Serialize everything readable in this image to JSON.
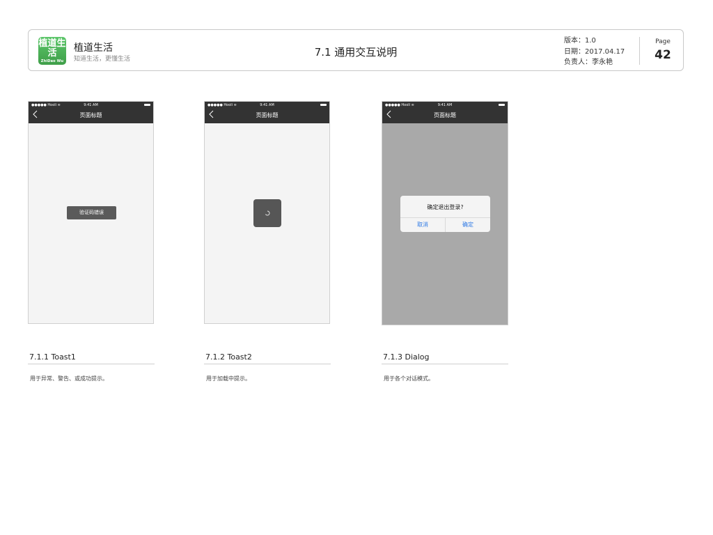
{
  "header": {
    "logo": {
      "main": "植道生活",
      "sub": "ZhiDao Wu",
      "color": "#4caf50"
    },
    "app_name": "植道生活",
    "slogan": "知道生活，更懂生活",
    "page_title": "7.1 通用交互说明",
    "version": "版本：1.0",
    "date": "日期：2017.04.17",
    "owner": "负责人：李永艳",
    "page_label": "Page",
    "page_number": "42"
  },
  "phone_common": {
    "carrier": "●●●●● Hooli",
    "time": "9:41 AM",
    "nav_title": "页面标题",
    "nav_color": "#333333",
    "back_icon": "chevron-left-icon",
    "wifi_icon": "wifi-icon",
    "battery_icon": "battery-icon"
  },
  "screens": {
    "toast1": {
      "toast_text": "验证码错误"
    },
    "toast2": {
      "loading_icon": "spinner-icon"
    },
    "dialog": {
      "title": "确定退出登录?",
      "cancel": "取消",
      "confirm": "确定",
      "button_color": "#2f7ae5"
    }
  },
  "captions": [
    {
      "title": "7.1.1 Toast1",
      "desc": "用于异常、警告、或成功提示。"
    },
    {
      "title": "7.1.2 Toast2",
      "desc": "用于加载中提示。"
    },
    {
      "title": "7.1.3 Dialog",
      "desc": "用于各个对话模式。"
    }
  ]
}
